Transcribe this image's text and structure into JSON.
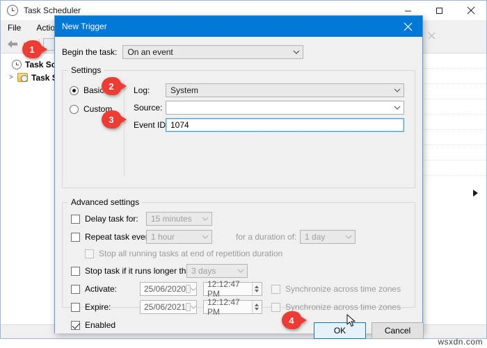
{
  "background_window": {
    "title": "Task Scheduler",
    "app_icon": "clock-icon",
    "window_controls": {
      "minimize": "minimize-icon",
      "maximize": "maximize-icon",
      "close": "close-icon"
    },
    "menu": [
      "File",
      "Action"
    ],
    "toolbar": {
      "back": "back-arrow-icon",
      "forward": "forward-arrow-icon"
    },
    "tree": [
      {
        "label": "Task Sche",
        "icon": "clock-icon",
        "bold": true
      },
      {
        "label": "Task S",
        "icon": "folder-clock-icon",
        "expander": ">"
      }
    ],
    "secondary_close": "close-icon"
  },
  "dialog": {
    "title": "New Trigger",
    "close_icon": "close-icon",
    "begin": {
      "label": "Begin the task:",
      "value": "On an event",
      "chevron": "chevron-down-icon"
    },
    "settings": {
      "group_title": "Settings",
      "radios": [
        {
          "label": "Basic",
          "selected": true
        },
        {
          "label": "Custom",
          "selected": false
        }
      ],
      "fields": [
        {
          "label": "Log:",
          "value": "System",
          "disabled": true,
          "chevron": "chevron-down-icon"
        },
        {
          "label": "Source:",
          "value": "",
          "disabled": false,
          "chevron": "chevron-down-icon"
        },
        {
          "label": "Event ID:",
          "value": "1074",
          "focused": true
        }
      ]
    },
    "advanced": {
      "group_title": "Advanced settings",
      "delay": {
        "label": "Delay task for:",
        "checked": false,
        "value": "15 minutes",
        "chevron": "chevron-down-icon"
      },
      "repeat": {
        "label": "Repeat task every:",
        "checked": false,
        "value": "1 hour",
        "chevron": "chevron-down-icon"
      },
      "duration": {
        "label": "for a duration of:",
        "value": "1 day",
        "chevron": "chevron-down-icon"
      },
      "stop_all": {
        "label": "Stop all running tasks at end of repetition duration",
        "checked": false
      },
      "stop_longer": {
        "label": "Stop task if it runs longer than:",
        "checked": false,
        "value": "3 days",
        "chevron": "chevron-down-icon"
      },
      "activate": {
        "label": "Activate:",
        "checked": false,
        "date": "25/06/2020",
        "time": "12:12:47 PM",
        "sync_label": "Synchronize across time zones",
        "sync_checked": false
      },
      "expire": {
        "label": "Expire:",
        "checked": false,
        "date": "25/06/2021",
        "time": "12:12:47 PM",
        "sync_label": "Synchronize across time zones",
        "sync_checked": false
      },
      "enabled": {
        "label": "Enabled",
        "checked": true
      }
    },
    "buttons": {
      "ok": "OK",
      "cancel": "Cancel"
    }
  },
  "callouts": [
    {
      "number": "1"
    },
    {
      "number": "2"
    },
    {
      "number": "3"
    },
    {
      "number": "4"
    }
  ],
  "watermark": "wsxdn.com",
  "colors": {
    "titlebar_blue": "#0078d7",
    "callout_red": "#ee3b33",
    "focus_blue": "#4a9de0",
    "selection_blue": "#9dc0e2"
  }
}
